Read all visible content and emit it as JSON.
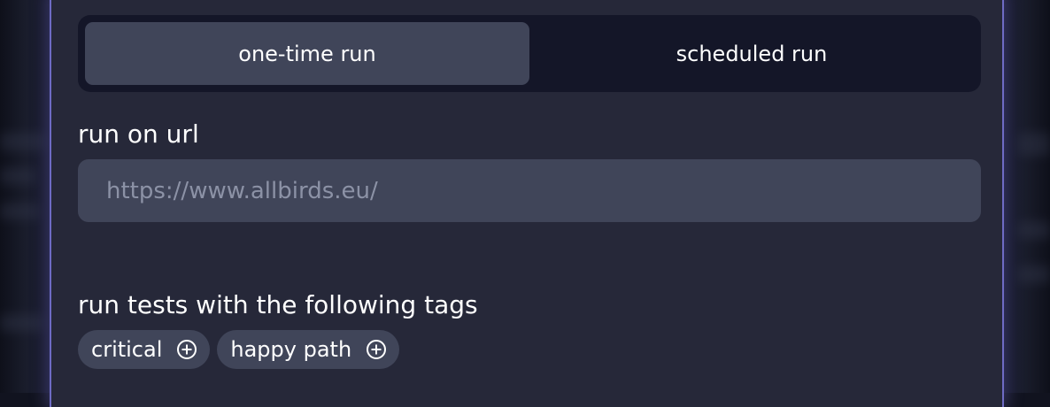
{
  "run_mode": {
    "tabs": [
      {
        "label": "one-time run",
        "active": true
      },
      {
        "label": "scheduled run",
        "active": false
      }
    ]
  },
  "url_field": {
    "label": "run on url",
    "placeholder": "https://www.allbirds.eu/",
    "value": ""
  },
  "tags_section": {
    "label": "run tests with the following tags",
    "tags": [
      {
        "label": "critical",
        "icon": "plus-circle-icon"
      },
      {
        "label": "happy path",
        "icon": "plus-circle-icon"
      }
    ]
  },
  "colors": {
    "panel_bg": "#262839",
    "panel_border": "#6e6bc4",
    "segmented_bg": "#141628",
    "active_tab_bg": "#404559",
    "input_bg": "#404559",
    "placeholder": "#8c92a6",
    "text": "#ffffff"
  }
}
